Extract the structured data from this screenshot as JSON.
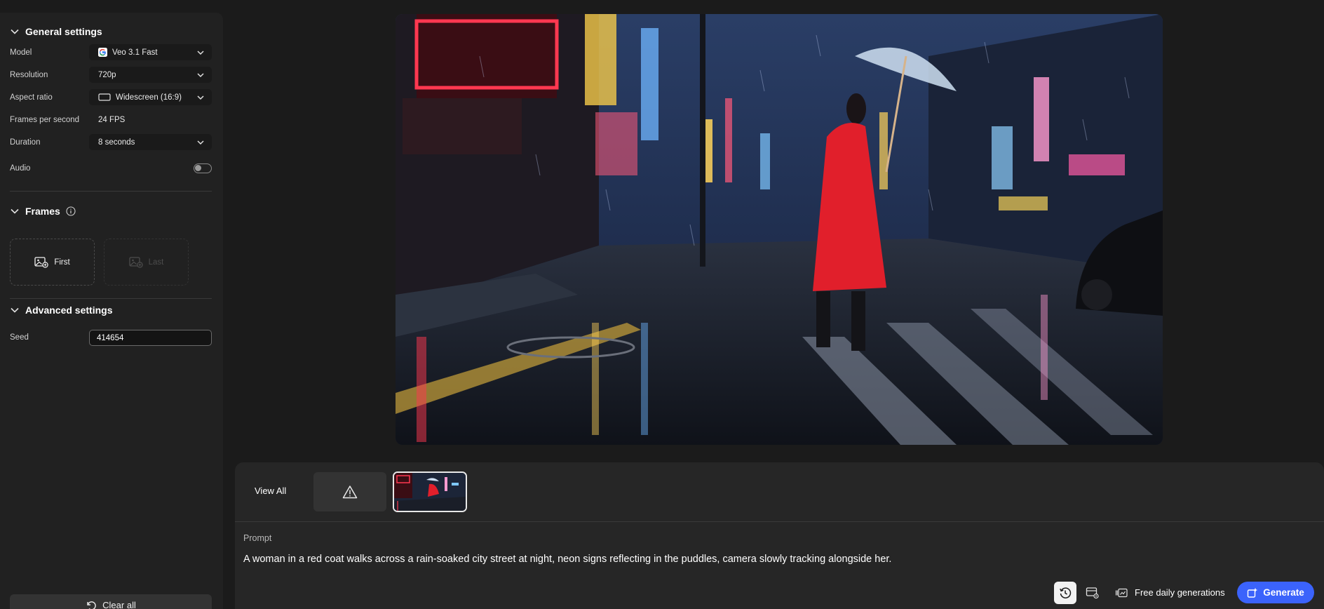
{
  "colors": {
    "accent": "#3b63fb",
    "panel": "#212121",
    "background": "#1b1b1b"
  },
  "general": {
    "title": "General settings",
    "model": {
      "label": "Model",
      "value": "Veo 3.1 Fast",
      "icon": "google-logo-icon"
    },
    "resolution": {
      "label": "Resolution",
      "value": "720p"
    },
    "aspect": {
      "label": "Aspect ratio",
      "value": "Widescreen (16:9)",
      "icon": "aspect-rect-icon"
    },
    "fps": {
      "label": "Frames per second",
      "value": "24 FPS"
    },
    "duration": {
      "label": "Duration",
      "value": "8 seconds"
    },
    "audio": {
      "label": "Audio",
      "enabled": false
    }
  },
  "frames": {
    "title": "Frames",
    "first": "First",
    "last": "Last"
  },
  "advanced": {
    "title": "Advanced settings",
    "seed_label": "Seed",
    "seed_value": "414654"
  },
  "clear_all": "Clear all",
  "gallery": {
    "view_all": "View All"
  },
  "prompt": {
    "label": "Prompt",
    "text": "A woman in a red coat walks across a rain-soaked city street at night, neon signs reflecting in the puddles, camera slowly tracking alongside her."
  },
  "footer": {
    "free_generations": "Free daily generations",
    "generate": "Generate"
  }
}
